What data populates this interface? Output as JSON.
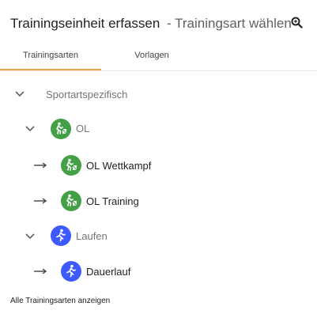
{
  "header": {
    "title": "Trainingseinheit erfassen",
    "subtitle": "- Trainingsart wählen",
    "search_icon": "search-icon"
  },
  "tabs": [
    {
      "label": "Trainingsarten",
      "active": true
    },
    {
      "label": "Vorlagen",
      "active": false
    }
  ],
  "tree": {
    "root": {
      "label": "Sportartspezifisch",
      "expanded": true
    },
    "groups": [
      {
        "label": "OL",
        "icon": "orienteering-icon",
        "color": "#43a047",
        "expanded": true,
        "children": [
          {
            "label": "OL Wettkampf",
            "icon": "orienteering-icon"
          },
          {
            "label": "OL Training",
            "icon": "orienteering-icon"
          }
        ]
      },
      {
        "label": "Laufen",
        "icon": "running-icon",
        "color": "#3d5afe",
        "expanded": true,
        "children": [
          {
            "label": "Dauerlauf",
            "icon": "running-icon"
          }
        ]
      }
    ]
  },
  "footer": {
    "show_all": "Alle Trainingsarten anzeigen"
  },
  "colors": {
    "accent": "#f0a24a",
    "green": "#43a047",
    "blue": "#3d5afe"
  }
}
